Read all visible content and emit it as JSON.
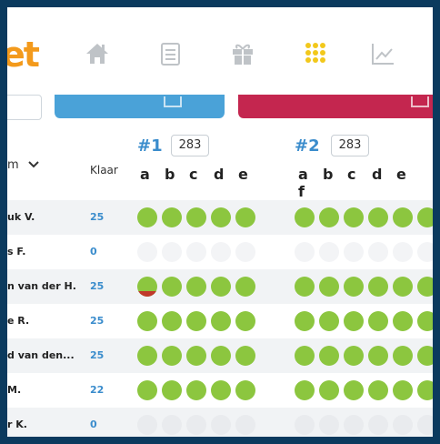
{
  "app": {
    "logo_text": "et",
    "colors": {
      "accent": "#f39a1c",
      "green": "#8cc63f",
      "blue": "#3a8ccc",
      "red": "#c4264f",
      "yellow": "#f2c81c"
    }
  },
  "nav": [
    {
      "icon": "home-icon"
    },
    {
      "icon": "list-icon"
    },
    {
      "icon": "gift-icon"
    },
    {
      "icon": "grid-icon",
      "active": true
    },
    {
      "icon": "chart-icon"
    }
  ],
  "table": {
    "name_header": "m",
    "klaar_header": "Klaar",
    "groups": [
      {
        "title": "#1",
        "score": "283",
        "letters": [
          "a",
          "b",
          "c",
          "d",
          "e"
        ]
      },
      {
        "title": "#2",
        "score": "283",
        "letters": [
          "a",
          "b",
          "c",
          "d",
          "e",
          "f"
        ]
      }
    ],
    "rows": [
      {
        "name": "uk V.",
        "klaar": "25",
        "g1": [
          "on",
          "on",
          "on",
          "on",
          "on"
        ],
        "g2": [
          "on",
          "on",
          "on",
          "on",
          "on",
          "on"
        ]
      },
      {
        "name": "s F.",
        "klaar": "0",
        "g1": [
          "off",
          "off",
          "off",
          "off",
          "off"
        ],
        "g2": [
          "off",
          "off",
          "off",
          "off",
          "off",
          "off"
        ]
      },
      {
        "name": "n van der H.",
        "klaar": "25",
        "g1": [
          "partial",
          "on",
          "on",
          "on",
          "on"
        ],
        "g2": [
          "on",
          "on",
          "on",
          "on",
          "on",
          "on"
        ]
      },
      {
        "name": "e R.",
        "klaar": "25",
        "g1": [
          "on",
          "on",
          "on",
          "on",
          "on"
        ],
        "g2": [
          "on",
          "on",
          "on",
          "on",
          "on",
          "on"
        ]
      },
      {
        "name": "d van den...",
        "klaar": "25",
        "g1": [
          "on",
          "on",
          "on",
          "on",
          "on"
        ],
        "g2": [
          "on",
          "on",
          "on",
          "on",
          "on",
          "on"
        ]
      },
      {
        "name": "M.",
        "klaar": "22",
        "g1": [
          "on",
          "on",
          "on",
          "on",
          "on"
        ],
        "g2": [
          "on",
          "on",
          "on",
          "on",
          "on",
          "on"
        ]
      },
      {
        "name": "r K.",
        "klaar": "0",
        "g1": [
          "off",
          "off",
          "off",
          "off",
          "off"
        ],
        "g2": [
          "off",
          "off",
          "off",
          "off",
          "off",
          "off"
        ]
      }
    ]
  }
}
